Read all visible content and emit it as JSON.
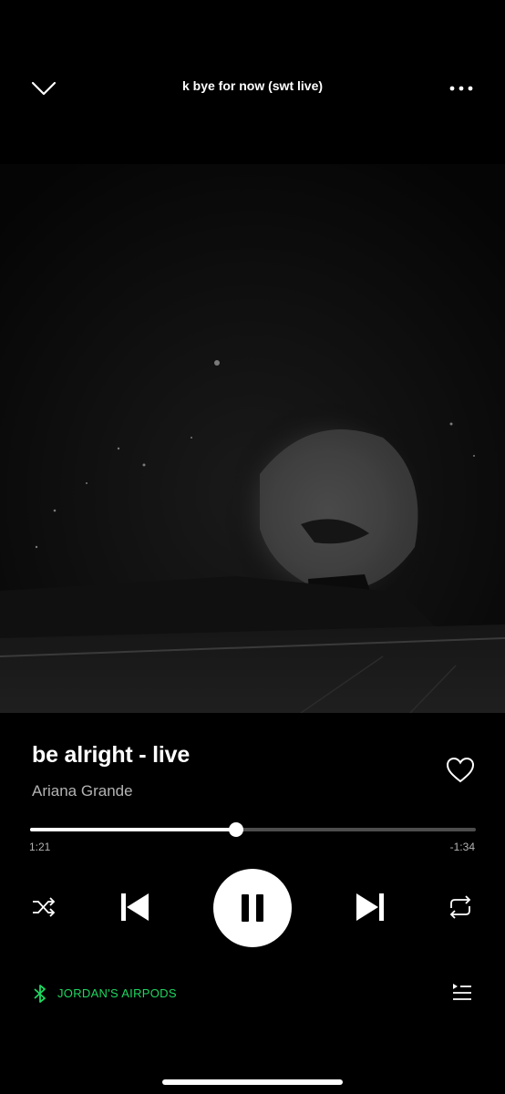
{
  "header": {
    "title": "k bye for now (swt live)",
    "collapse_icon": "chevron-down-icon",
    "more_icon": "more-dots-icon"
  },
  "artwork": {
    "description_icon": "album-artwork"
  },
  "track": {
    "title": "be alright - live",
    "artist": "Ariana Grande",
    "liked": false
  },
  "progress": {
    "elapsed": "1:21",
    "remaining": "-1:34",
    "fraction": 0.463
  },
  "controls": {
    "shuffle_icon": "shuffle-icon",
    "previous_icon": "skip-previous-icon",
    "play_state": "playing",
    "pause_icon": "pause-icon",
    "next_icon": "skip-next-icon",
    "repeat_icon": "repeat-icon"
  },
  "device": {
    "name": "JORDAN'S AIRPODS",
    "icon": "bluetooth-icon",
    "color": "#1ed760"
  },
  "queue": {
    "icon": "queue-icon"
  },
  "colors": {
    "background": "#000000",
    "accent": "#1ed760",
    "secondary_text": "#b3b3b3",
    "progress_track": "#4d4d4d"
  }
}
